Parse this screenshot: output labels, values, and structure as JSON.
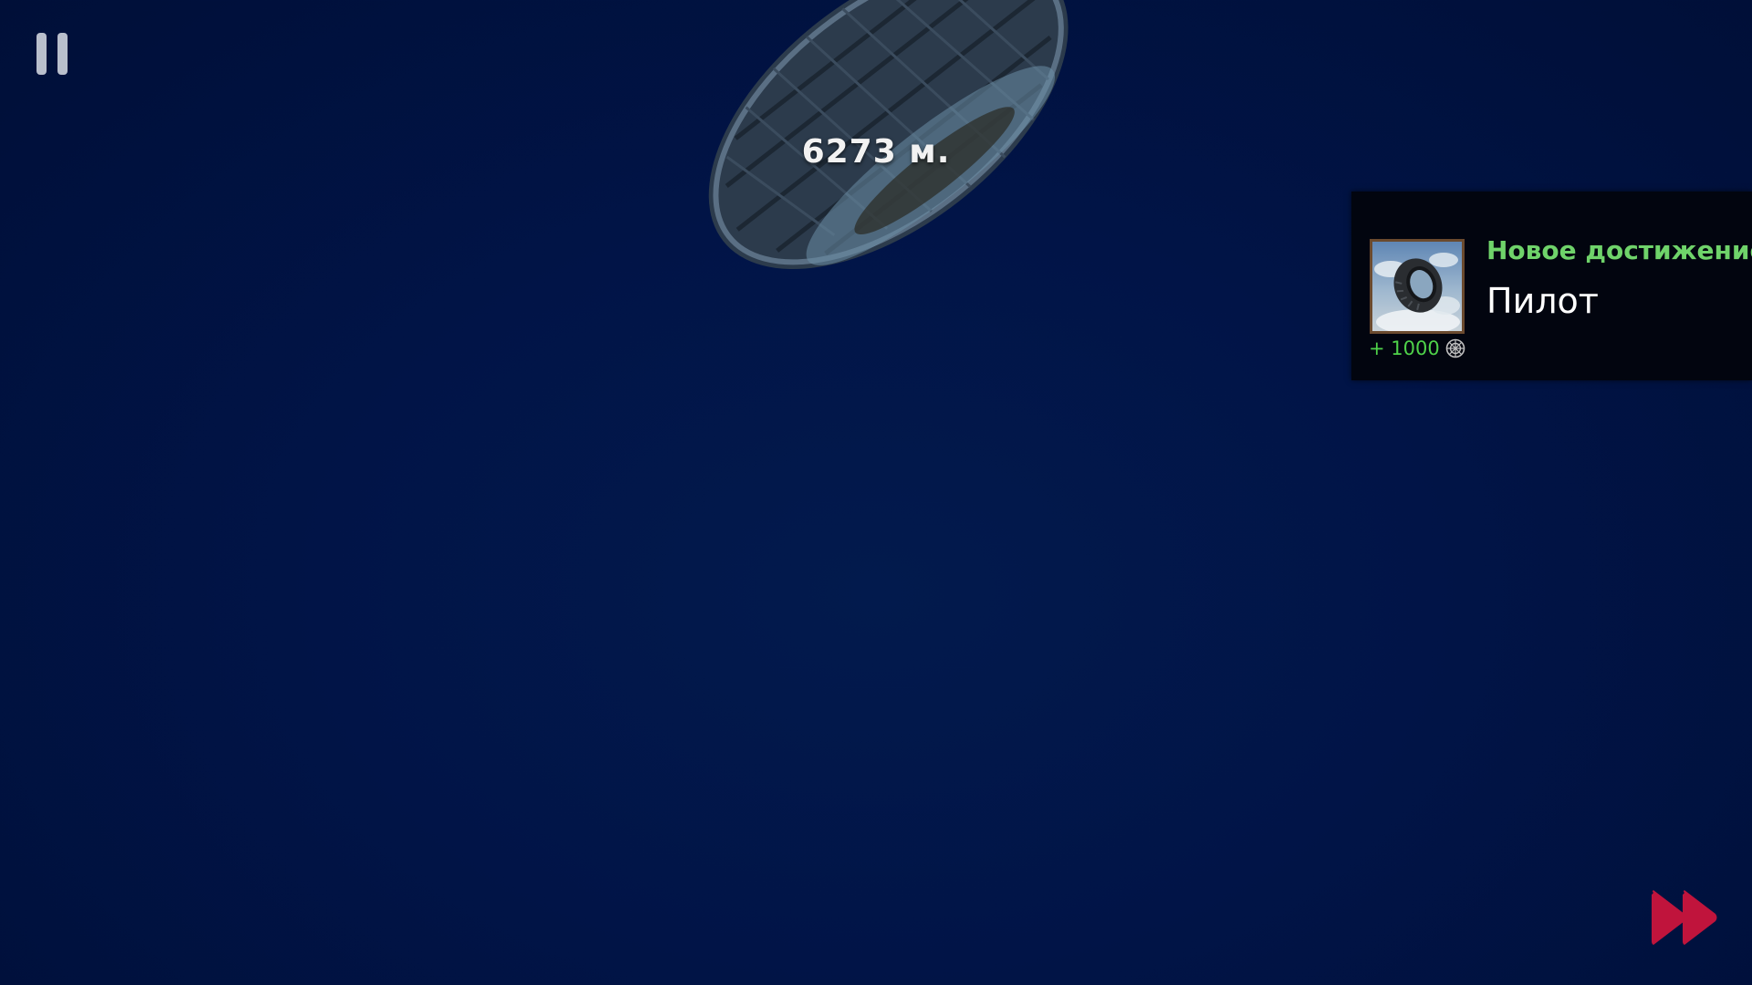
{
  "hud": {
    "distance_text": "6273 м.",
    "pause_icon": "pause-icon",
    "skip_icon": "fast-forward-icon"
  },
  "achievement": {
    "header": "Новое достижение",
    "name": "Пилот",
    "reward": "+ 1000",
    "reward_icon": "coin-icon",
    "image_icon": "flying-tire-icon"
  },
  "colors": {
    "background": "#011447",
    "achievement_header": "#6fd36a",
    "reward_text": "#4fd24a",
    "skip_button": "#c0143c",
    "pause_button": "#b9bfcc"
  }
}
